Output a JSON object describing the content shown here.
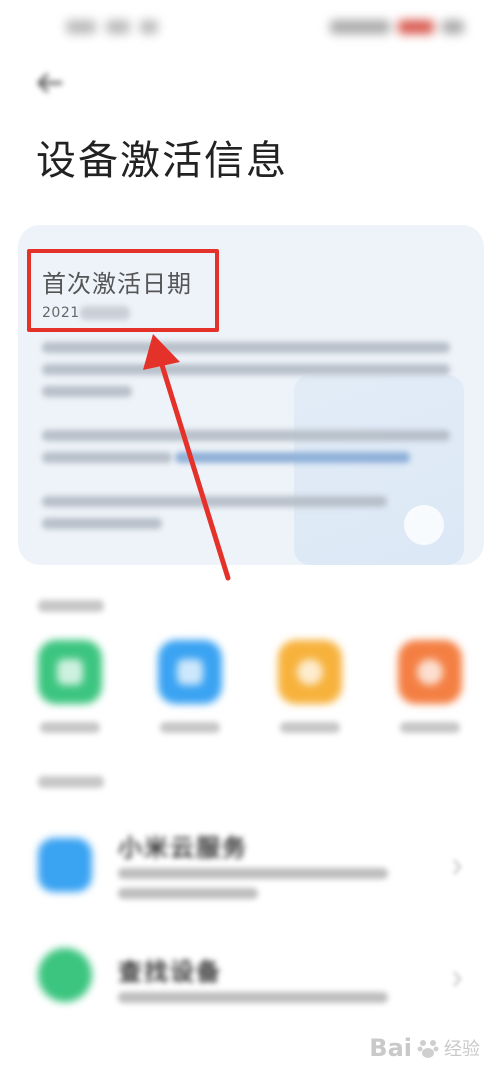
{
  "page": {
    "title": "设备激活信息"
  },
  "card": {
    "heading": "首次激活日期",
    "date_visible": "2021"
  },
  "list": {
    "item1_title": "小米云服务",
    "item2_title": "查找设备"
  },
  "watermark": {
    "brand_a": "Bai",
    "brand_b": "经验"
  },
  "colors": {
    "highlight": "#e4322b",
    "card_bg": "#eef3f9",
    "shortcut_green": "#3cc57f",
    "shortcut_blue": "#3aa3f2",
    "shortcut_yellow": "#f7b23c",
    "shortcut_orange": "#f47f43"
  },
  "icons": {
    "back": "arrow-left-icon",
    "chevron": "chevron-right-icon"
  }
}
